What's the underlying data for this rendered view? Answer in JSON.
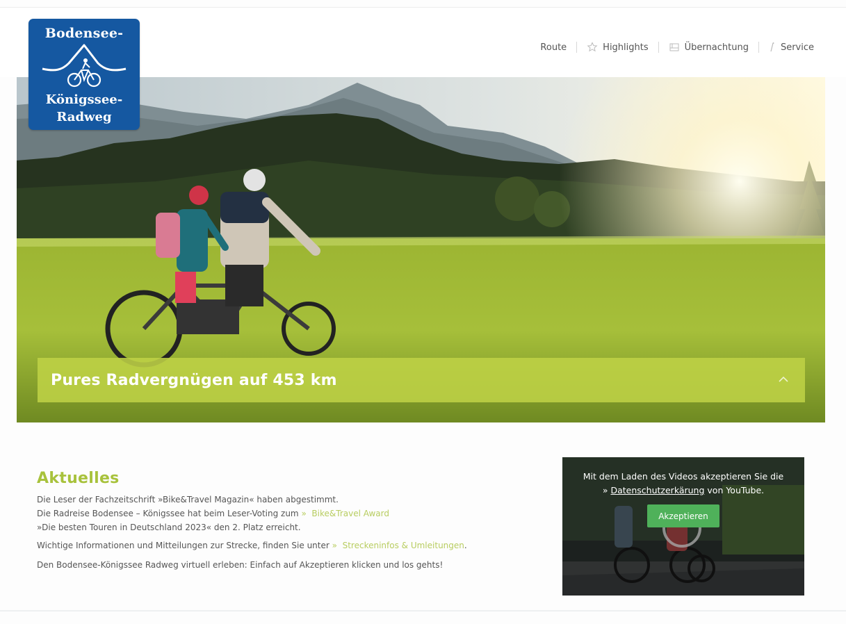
{
  "logo": {
    "line1": "Bodensee-",
    "line2": "Königssee-",
    "line3": "Radweg"
  },
  "nav": {
    "items": [
      {
        "label": "Route",
        "icon": ""
      },
      {
        "label": "Highlights",
        "icon": "star-icon"
      },
      {
        "label": "Übernachtung",
        "icon": "bed-icon"
      },
      {
        "label": "Service",
        "icon": "info-icon"
      }
    ]
  },
  "hero": {
    "banner_title": "Pures Radvergnügen auf 453 km"
  },
  "news": {
    "heading": "Aktuelles",
    "p1_line1": "Die Leser der Fachzeitschrift »Bike&Travel Magazin« haben abgestimmt.",
    "p1_line2_pre": "Die Radreise Bodensee – Königssee hat beim Leser-Voting zum ",
    "p1_line2_arrow": "»",
    "p1_line2_link": "Bike&Travel Award",
    "p1_line3": "»Die besten Touren in Deutschland 2023« den 2. Platz erreicht.",
    "p2_pre": "Wichtige Informationen und Mitteilungen zur Strecke, finden Sie unter ",
    "p2_arrow": "»",
    "p2_link": "Streckeninfos & Umleitungen",
    "p2_post": ".",
    "p3": "Den Bodensee-Königssee Radweg virtuell erleben: Einfach auf Akzeptieren klicken und los gehts!"
  },
  "video": {
    "line1": "Mit dem Laden des Videos akzeptieren Sie die",
    "link_arrow": "»",
    "link": "Datenschutzerkärung",
    "line2_post": " von YouTube.",
    "button": "Akzeptieren"
  },
  "colors": {
    "brand_blue": "#1558a1",
    "accent_green": "#a8c23c",
    "button_green": "#4fb15a"
  }
}
